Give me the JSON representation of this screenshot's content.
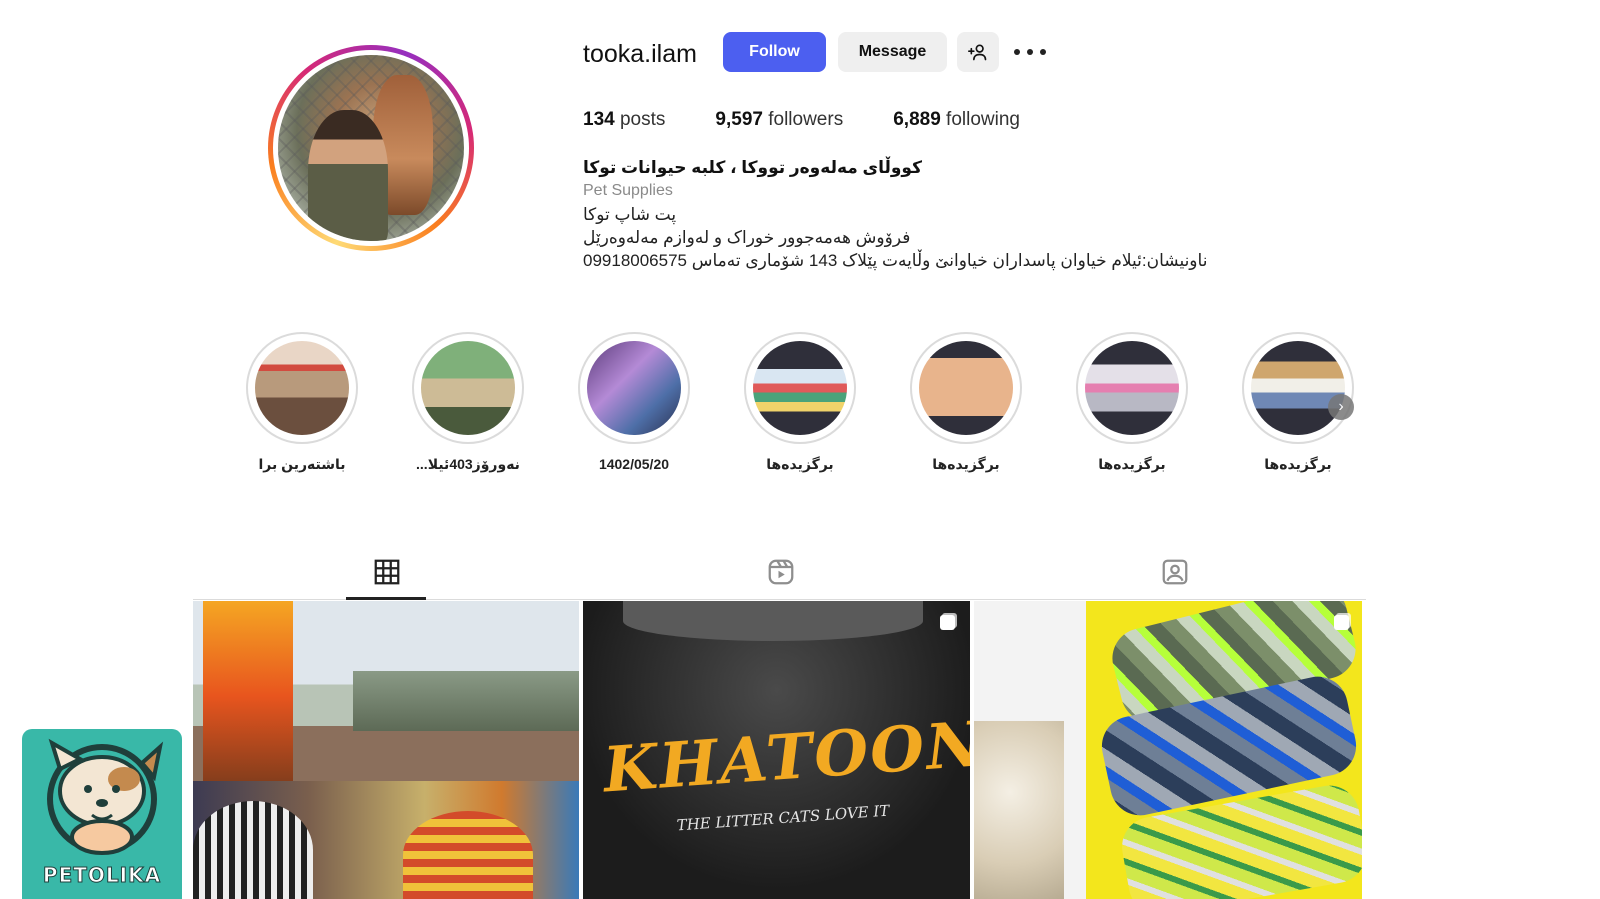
{
  "profile": {
    "username": "tooka.ilam",
    "follow_label": "Follow",
    "message_label": "Message",
    "posts_count": "134",
    "posts_label": "posts",
    "followers_count": "9,597",
    "followers_label": "followers",
    "following_count": "6,889",
    "following_label": "following",
    "bio_name": "کووڵای مەلەوەر تووکا ، کلبه حیوانات توکا",
    "bio_category": "Pet Supplies",
    "bio_lines": [
      "پت شاپ توکا",
      "فرۆوش هەمەجوور خوراک و لەوازم مەلەوەرێل",
      "ناونیشان:ئیلام خیاوان پاسداران خیاوانێ وڵایەت پێلاک 143 شۆماری تەماس 09918006575"
    ]
  },
  "highlights": [
    {
      "label": "باشتەرین برا"
    },
    {
      "label": "نەورۆز403ئیلا..."
    },
    {
      "label": "1402/05/20"
    },
    {
      "label": "برگزیده‌ها"
    },
    {
      "label": "برگزیده‌ها"
    },
    {
      "label": "برگزیده‌ها"
    },
    {
      "label": "برگزیده‌ها"
    }
  ],
  "tabs": [
    {
      "name": "posts",
      "icon": "grid-icon",
      "active": true
    },
    {
      "name": "reels",
      "icon": "reels-icon",
      "active": false
    },
    {
      "name": "tagged",
      "icon": "tagged-icon",
      "active": false
    }
  ],
  "posts": [
    {
      "desc_icon": "none"
    },
    {
      "desc_icon": "multi-post-icon",
      "bag_text": "KHATOON",
      "bag_sub": "THE LITTER CATS LOVE IT"
    },
    {
      "desc_icon": "multi-post-icon"
    }
  ],
  "watermark": {
    "text": "PETOLIKA"
  },
  "colors": {
    "follow_bg": "#4c5ff0",
    "secondary_btn_bg": "#efefef",
    "watermark_bg": "#39b8a8"
  }
}
